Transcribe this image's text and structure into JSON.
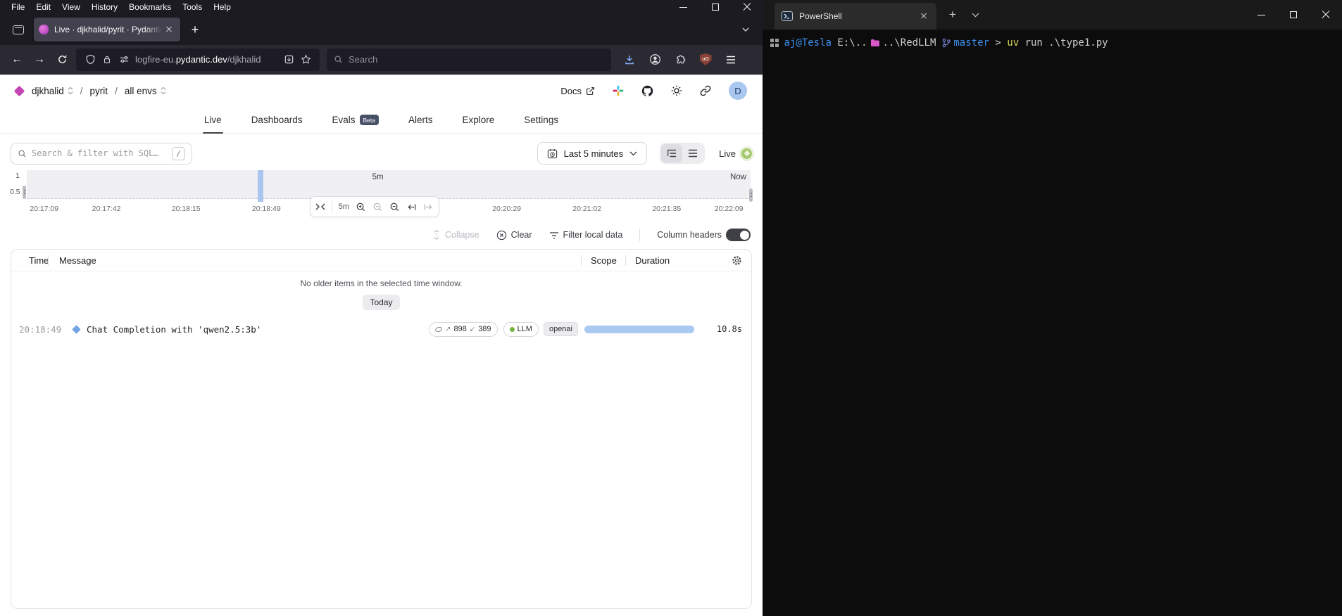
{
  "browser": {
    "menu": [
      "File",
      "Edit",
      "View",
      "History",
      "Bookmarks",
      "Tools",
      "Help"
    ],
    "tab_title": "Live · djkhalid/pyrit · Pydantic L",
    "new_tab_label": "+",
    "url_prefix": "logfire-eu.",
    "url_host": "pydantic.dev",
    "url_path": "/djkhalid",
    "search_placeholder": "Search",
    "ublock_badge": "uO"
  },
  "logfire": {
    "org": "djkhalid",
    "sep": "/",
    "project": "pyrit",
    "environment": "all envs",
    "docs_label": "Docs",
    "avatar_initial": "D",
    "nav": {
      "live": "Live",
      "dashboards": "Dashboards",
      "evals": "Evals",
      "evals_badge": "Beta",
      "alerts": "Alerts",
      "explore": "Explore",
      "settings": "Settings"
    },
    "filter_bar": {
      "search_placeholder": "Search & filter with SQL…",
      "shortcut_key": "/",
      "time_range": "Last 5 minutes",
      "live_label": "Live"
    },
    "timeline": {
      "window_label": "5m",
      "now_label": "Now",
      "zoom_level": "5m",
      "y_tick_top": "1",
      "y_tick_bottom": "0.5",
      "x_ticks": [
        "20:17:09",
        "20:17:42",
        "20:18:15",
        "20:18:49",
        "20:20:29",
        "20:21:02",
        "20:21:35",
        "20:22:09"
      ]
    },
    "actions": {
      "collapse": "Collapse",
      "clear": "Clear",
      "filter_local": "Filter local data",
      "column_headers": "Column headers"
    },
    "table": {
      "col_time": "Time",
      "col_message": "Message",
      "col_scope": "Scope",
      "col_duration": "Duration",
      "empty_message": "No older items in the selected time window.",
      "day_separator": "Today",
      "row": {
        "time": "20:18:49",
        "message": "Chat Completion with 'qwen2.5:3b'",
        "tokens_up_arrow": "↗",
        "tokens_in": "898",
        "tokens_down_arrow": "↙",
        "tokens_out": "389",
        "scope_label": "LLM",
        "scope_tag": "openai",
        "duration": "10.8s"
      }
    }
  },
  "terminal": {
    "tab_title": "PowerShell",
    "new_tab_label": "+",
    "prompt": {
      "user_host": "aj@Tesla",
      "path_start": " E:\\..",
      "path_end": "..\\RedLLM",
      "branch": "master",
      "chevron": ">",
      "cmd_program": "uv",
      "cmd_args": "run .\\type1.py"
    }
  },
  "colors": {
    "timeline_bar": "#a9c6ee",
    "duration_bar": "#a9c9f0",
    "live_dot": "#a6c86e",
    "llm_dot": "#74b53c",
    "logo": "#c445b4",
    "prompt_blue": "#3b8eea",
    "prompt_yellow": "#d5d55a",
    "prompt_pink": "#d959c9"
  }
}
